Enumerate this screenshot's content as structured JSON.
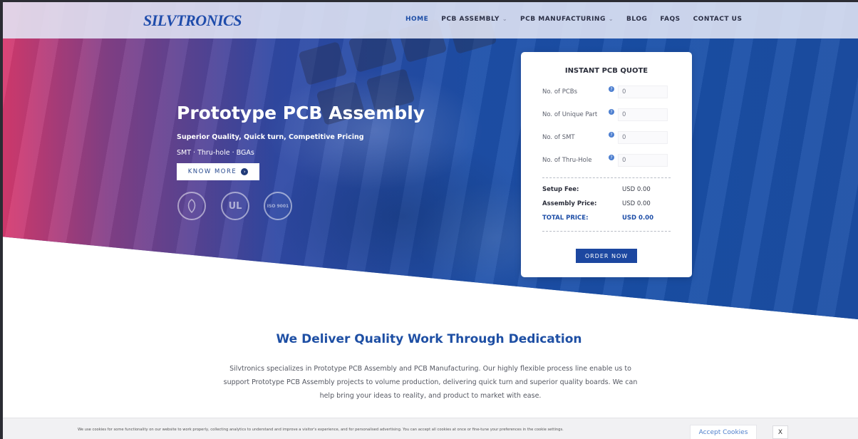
{
  "nav": {
    "logo": "SILVTRONICS",
    "items": [
      {
        "label": "HOME",
        "active": true,
        "dropdown": false
      },
      {
        "label": "PCB ASSEMBLY",
        "active": false,
        "dropdown": true
      },
      {
        "label": "PCB MANUFACTURING",
        "active": false,
        "dropdown": true
      },
      {
        "label": "BLOG",
        "active": false,
        "dropdown": false
      },
      {
        "label": "FAQS",
        "active": false,
        "dropdown": false
      },
      {
        "label": "CONTACT US",
        "active": false,
        "dropdown": false
      }
    ]
  },
  "hero": {
    "title": "Prototype PCB Assembly",
    "subtitle": "Superior Quality, Quick turn, Competitive Pricing",
    "tags": "SMT · Thru-hole · BGAs",
    "button": "KNOW MORE",
    "badges": [
      "lead-free-icon",
      "ul-certification-icon",
      "iso-9001-icon"
    ],
    "badge_labels": [
      "",
      "UL",
      "ISO 9001"
    ]
  },
  "quote": {
    "title": "INSTANT PCB QUOTE",
    "fields": [
      {
        "label": "No. of PCBs",
        "value": "0"
      },
      {
        "label": "No. of Unique Part",
        "value": "0"
      },
      {
        "label": "No. of SMT",
        "value": "0"
      },
      {
        "label": "No. of Thru-Hole",
        "value": "0"
      }
    ],
    "setup_fee_label": "Setup Fee:",
    "setup_fee": "USD 0.00",
    "assembly_price_label": "Assembly Price:",
    "assembly_price": "USD 0.00",
    "total_label": "TOTAL PRICE:",
    "total": "USD 0.00",
    "order_button": "ORDER NOW"
  },
  "section": {
    "title": "We Deliver Quality Work Through Dedication",
    "text": "Silvtronics specializes in Prototype PCB Assembly and PCB Manufacturing. Our highly flexible process line enable us to support Prototype PCB Assembly projects to volume production, delivering quick turn and superior quality boards. We can help bring your ideas to reality, and product to market with ease."
  },
  "cookie": {
    "text": "We use cookies for some functionality on our website to work properly, collecting analytics to understand and improve a visitor's experience, and for personalised advertising. You can accept all cookies at once or fine-tune your preferences in the cookie settings.",
    "accept": "Accept Cookies",
    "close": "X"
  },
  "colors": {
    "brand": "#1e4ea6",
    "hero_pink": "#e23a6e",
    "hero_blue": "#1c4fa6"
  }
}
